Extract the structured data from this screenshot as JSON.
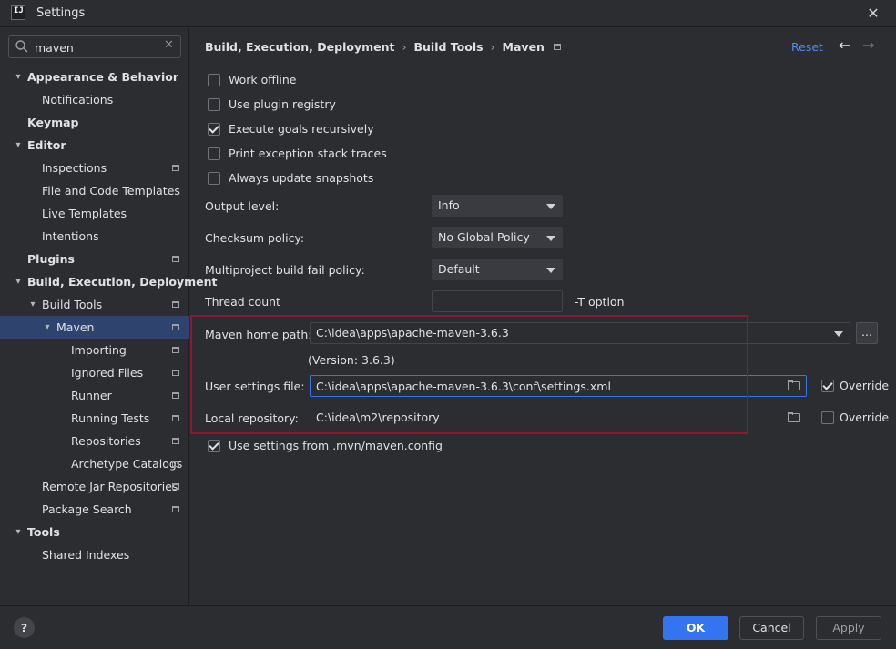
{
  "window": {
    "title": "Settings",
    "app_icon_text": "IJ"
  },
  "search": {
    "value": "maven"
  },
  "tree": [
    {
      "label": "Appearance & Behavior",
      "bold": true,
      "arrow": "expanded",
      "level": 0
    },
    {
      "label": "Notifications",
      "bold": false,
      "arrow": "none",
      "level": 1
    },
    {
      "label": "Keymap",
      "bold": true,
      "arrow": "none",
      "level": 0
    },
    {
      "label": "Editor",
      "bold": true,
      "arrow": "expanded",
      "level": 0
    },
    {
      "label": "Inspections",
      "bold": false,
      "arrow": "none",
      "level": 1,
      "project": true
    },
    {
      "label": "File and Code Templates",
      "bold": false,
      "arrow": "none",
      "level": 1
    },
    {
      "label": "Live Templates",
      "bold": false,
      "arrow": "none",
      "level": 1
    },
    {
      "label": "Intentions",
      "bold": false,
      "arrow": "none",
      "level": 1
    },
    {
      "label": "Plugins",
      "bold": true,
      "arrow": "none",
      "level": 0,
      "project": true
    },
    {
      "label": "Build, Execution, Deployment",
      "bold": true,
      "arrow": "expanded",
      "level": 0
    },
    {
      "label": "Build Tools",
      "bold": false,
      "arrow": "expanded",
      "level": 1,
      "project": true
    },
    {
      "label": "Maven",
      "bold": false,
      "arrow": "expanded",
      "level": 2,
      "project": true,
      "selected": true
    },
    {
      "label": "Importing",
      "bold": false,
      "arrow": "none",
      "level": 3,
      "project": true
    },
    {
      "label": "Ignored Files",
      "bold": false,
      "arrow": "none",
      "level": 3,
      "project": true
    },
    {
      "label": "Runner",
      "bold": false,
      "arrow": "none",
      "level": 3,
      "project": true
    },
    {
      "label": "Running Tests",
      "bold": false,
      "arrow": "none",
      "level": 3,
      "project": true
    },
    {
      "label": "Repositories",
      "bold": false,
      "arrow": "none",
      "level": 3,
      "project": true
    },
    {
      "label": "Archetype Catalogs",
      "bold": false,
      "arrow": "none",
      "level": 3,
      "project": true
    },
    {
      "label": "Remote Jar Repositories",
      "bold": false,
      "arrow": "none",
      "level": 1,
      "project": true
    },
    {
      "label": "Package Search",
      "bold": false,
      "arrow": "none",
      "level": 1,
      "project": true
    },
    {
      "label": "Tools",
      "bold": true,
      "arrow": "expanded",
      "level": 0
    },
    {
      "label": "Shared Indexes",
      "bold": false,
      "arrow": "none",
      "level": 1
    }
  ],
  "breadcrumb": {
    "part1": "Build, Execution, Deployment",
    "part2": "Build Tools",
    "part3": "Maven",
    "sep": "›"
  },
  "header": {
    "reset": "Reset",
    "back": "←",
    "forward": "→"
  },
  "options": {
    "work_offline": {
      "label": "Work offline",
      "checked": false
    },
    "use_plugin_registry": {
      "label": "Use plugin registry",
      "checked": false
    },
    "execute_goals_recursively": {
      "label": "Execute goals recursively",
      "checked": true
    },
    "print_exception_stack_traces": {
      "label": "Print exception stack traces",
      "checked": false
    },
    "always_update_snapshots": {
      "label": "Always update snapshots",
      "checked": false
    },
    "use_settings_mvn_config": {
      "label": "Use settings from .mvn/maven.config",
      "checked": true
    }
  },
  "output_level": {
    "label": "Output level:",
    "value": "Info"
  },
  "checksum_policy": {
    "label": "Checksum policy:",
    "value": "No Global Policy"
  },
  "multiproject_fail_policy": {
    "label": "Multiproject build fail policy:",
    "value": "Default"
  },
  "thread_count": {
    "label": "Thread count",
    "value": "",
    "hint": "-T option"
  },
  "maven_home": {
    "label": "Maven home path:",
    "value": "C:\\idea\\apps\\apache-maven-3.6.3",
    "version": "(Version: 3.6.3)",
    "browse": "..."
  },
  "user_settings": {
    "label": "User settings file:",
    "value": "C:\\idea\\apps\\apache-maven-3.6.3\\conf\\settings.xml",
    "override_label": "Override",
    "override_checked": true
  },
  "local_repo": {
    "label": "Local repository:",
    "value": "C:\\idea\\m2\\repository",
    "override_label": "Override",
    "override_checked": false
  },
  "footer": {
    "help": "?",
    "ok": "OK",
    "cancel": "Cancel",
    "apply": "Apply"
  },
  "colors": {
    "accent": "#3574f0",
    "selection": "#2e436e",
    "highlight_box": "#8d1a2c",
    "link": "#548af7"
  }
}
